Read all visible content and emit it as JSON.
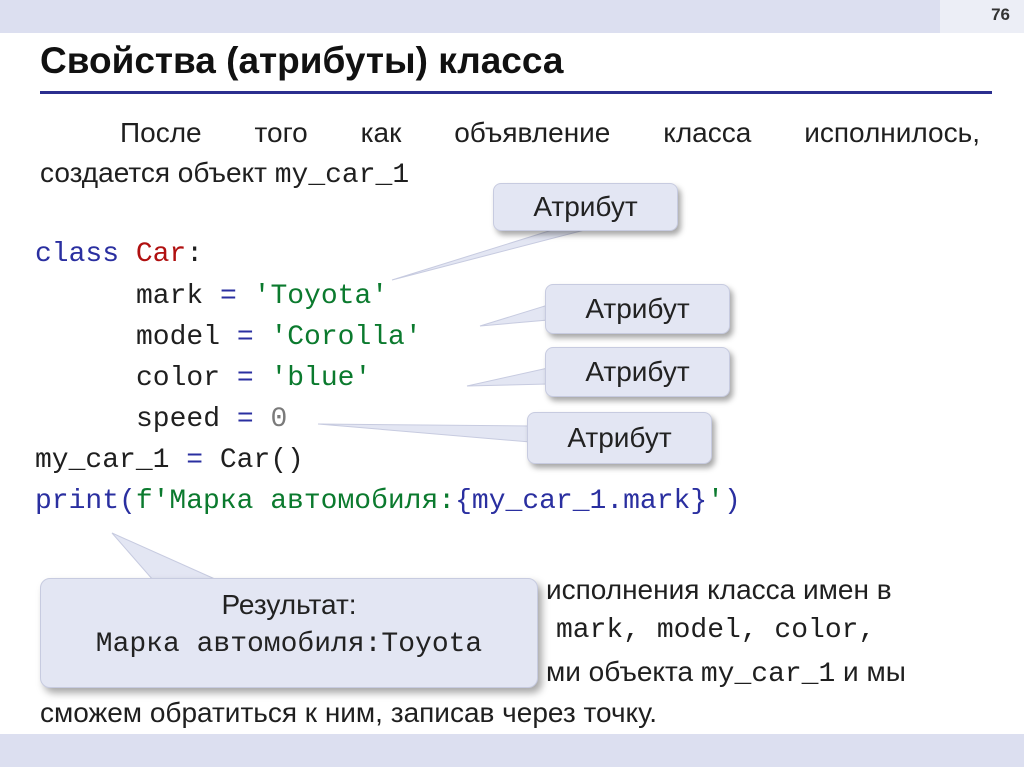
{
  "slide": {
    "number": "76",
    "title": "Свойства (атрибуты) класса"
  },
  "intro": {
    "line1": "После того как объявление класса исполнилось,",
    "line2_text": "создается объект ",
    "line2_code": "my_car_1"
  },
  "code": {
    "l1_kw": "class ",
    "l1_name": "Car",
    "l1_end": ":",
    "l2_var": "mark",
    "l2_op": " = ",
    "l2_val": "'Toyota'",
    "l3_var": "model",
    "l3_op": " = ",
    "l3_val": "'Corolla'",
    "l4_var": "color",
    "l4_op": " = ",
    "l4_val": "'blue'",
    "l5_var": "speed",
    "l5_op": " = ",
    "l5_val": "0",
    "l6_a": "my_car_1",
    "l6_op": " = ",
    "l6_b": "Car()",
    "l7_fn": "print(",
    "l7_str1": "f'Марка автомобиля:",
    "l7_br1": "{",
    "l7_expr": "my_car_1.mark",
    "l7_br2": "}",
    "l7_str2": "'",
    "l7_end": ")"
  },
  "callouts": [
    "Атрибут",
    "Атрибут",
    "Атрибут",
    "Атрибут"
  ],
  "result": {
    "label": "Результат:",
    "value": "Марка автомобиля:Toyota"
  },
  "bottom_text": {
    "line1": "исполнения класса имен в",
    "line2": "mark, model, color,",
    "line3_a": "ми объекта ",
    "line3_code": "my_car_1",
    "line3_b": " и мы",
    "line4": "сможем обратиться к ним, записав через точку."
  }
}
